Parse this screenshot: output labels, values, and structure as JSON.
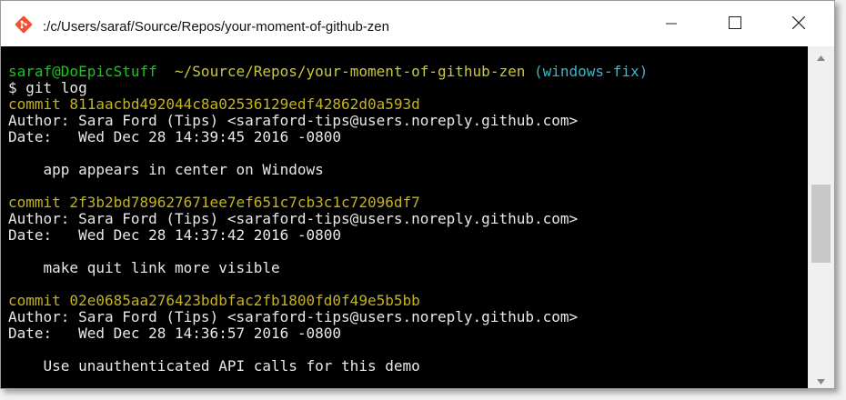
{
  "window": {
    "title": ":/c/Users/saraf/Source/Repos/your-moment-of-github-zen",
    "icon": "git-icon",
    "controls": {
      "minimize": "minimize-icon",
      "maximize": "maximize-icon",
      "close": "close-icon"
    }
  },
  "colors": {
    "terminal_bg": "#000000",
    "text": "#e8e8e8",
    "prompt_user": "#1cc41c",
    "prompt_path": "#c8c83a",
    "prompt_branch": "#3ab6c6",
    "commit": "#c4b31c",
    "git_icon": "#f05033"
  },
  "terminal": {
    "prompt": {
      "user_host": "saraf@DoEpicStuff",
      "path": "~/Source/Repos/your-moment-of-github-zen",
      "branch": "(windows-fix)"
    },
    "command": "$ git log",
    "commits": [
      {
        "hash_line": "commit 811aacbd492044c8a02536129edf42862d0a593d",
        "author_line": "Author: Sara Ford (Tips) <saraford-tips@users.noreply.github.com>",
        "date_line": "Date:   Wed Dec 28 14:39:45 2016 -0800",
        "message": "    app appears in center on Windows"
      },
      {
        "hash_line": "commit 2f3b2bd789627671ee7ef651c7cb3c1c72096df7",
        "author_line": "Author: Sara Ford (Tips) <saraford-tips@users.noreply.github.com>",
        "date_line": "Date:   Wed Dec 28 14:37:42 2016 -0800",
        "message": "    make quit link more visible"
      },
      {
        "hash_line": "commit 02e0685aa276423bdbfac2fb1800fd0f49e5b5bb",
        "author_line": "Author: Sara Ford (Tips) <saraford-tips@users.noreply.github.com>",
        "date_line": "Date:   Wed Dec 28 14:36:57 2016 -0800",
        "message": "    Use unauthenticated API calls for this demo"
      }
    ]
  }
}
